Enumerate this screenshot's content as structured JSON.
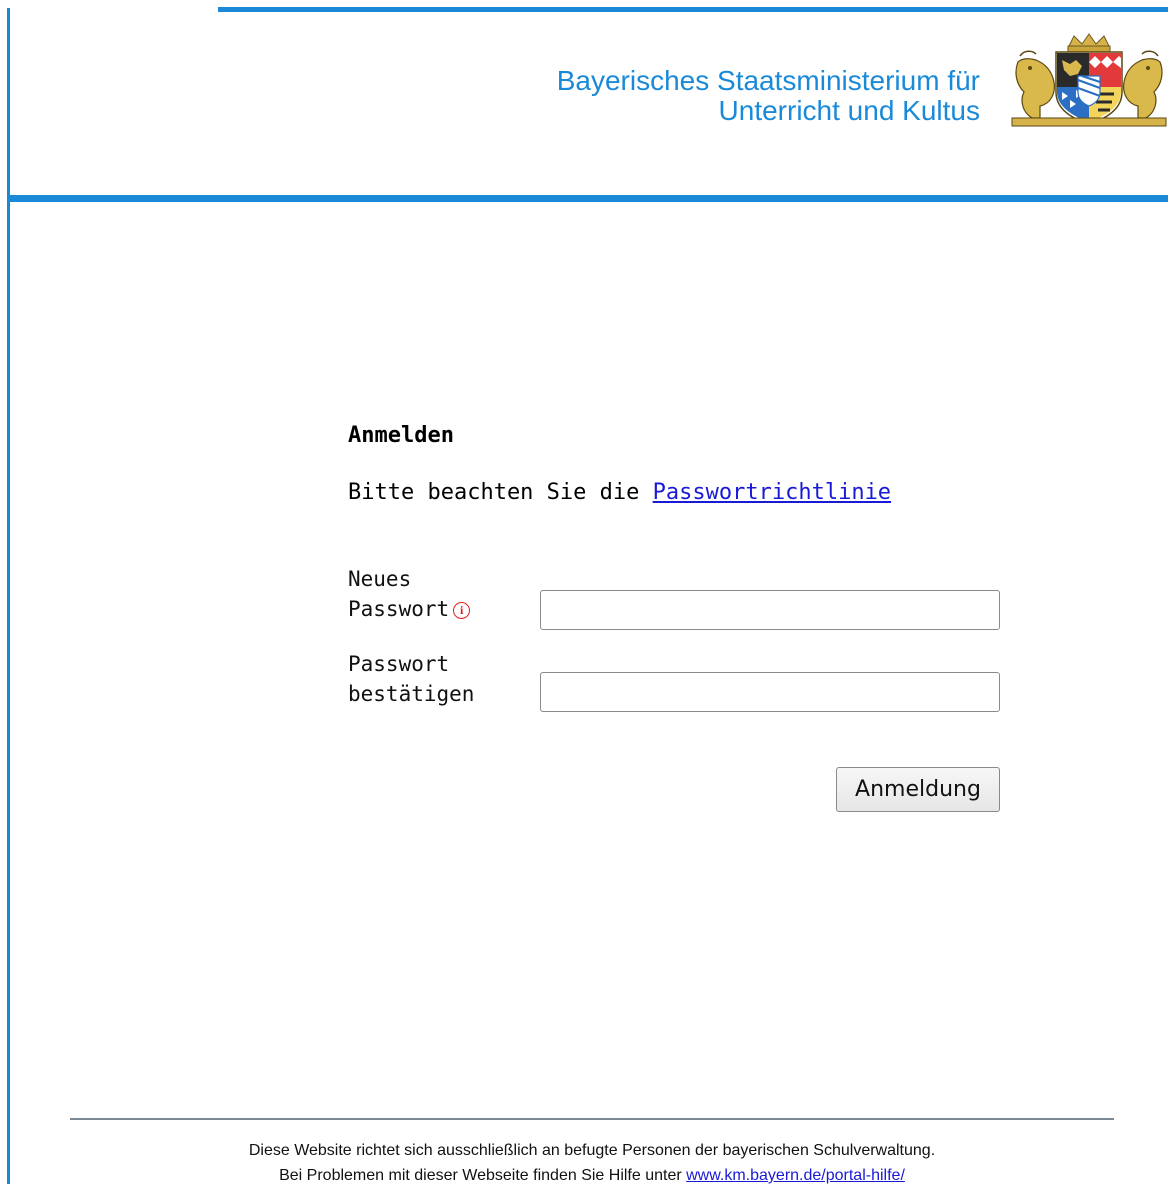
{
  "header": {
    "ministry_line1": "Bayerisches Staatsministerium für",
    "ministry_line2": "Unterricht und Kultus",
    "crest_icon": "bavarian-coat-of-arms-icon",
    "accent_color": "#1a8ad8"
  },
  "login": {
    "title": "Anmelden",
    "policy_text": "Bitte beachten Sie die ",
    "policy_link": "Passwortrichtlinie",
    "new_password_label_line1": "Neues",
    "new_password_label_line2": "Passwort",
    "new_password_value": "",
    "info_icon": "info-icon",
    "confirm_label_line1": "Passwort",
    "confirm_label_line2": "bestätigen",
    "confirm_value": "",
    "submit_label": "Anmeldung"
  },
  "footer": {
    "line1": "Diese Website richtet sich ausschließlich an befugte Personen der bayerischen Schulverwaltung.",
    "line2_prefix": "Bei Problemen mit dieser Webseite finden Sie Hilfe unter ",
    "help_link": "www.km.bayern.de/portal-hilfe/"
  }
}
